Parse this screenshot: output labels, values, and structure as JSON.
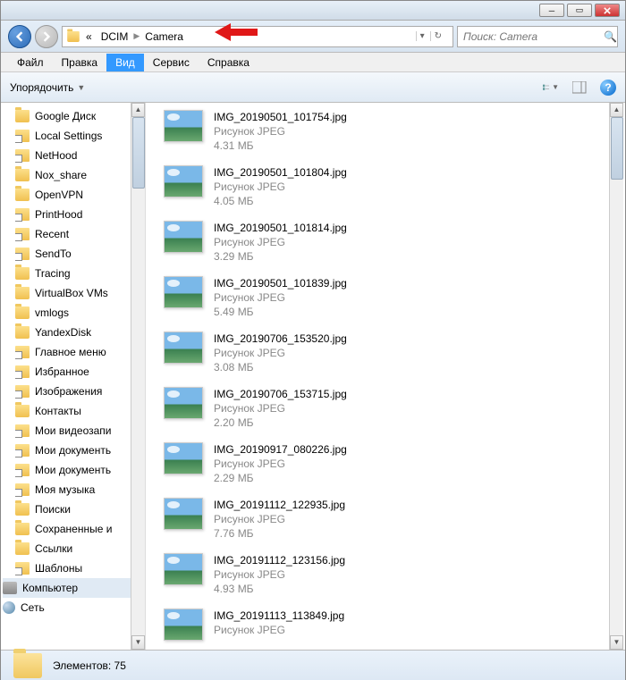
{
  "breadcrumb": {
    "root": "«",
    "p1": "DCIM",
    "p2": "Camera"
  },
  "search": {
    "placeholder": "Поиск: Camera"
  },
  "menu": {
    "file": "Файл",
    "edit": "Правка",
    "view": "Вид",
    "service": "Сервис",
    "help": "Справка"
  },
  "toolbar": {
    "organize": "Упорядочить"
  },
  "sidebar": {
    "items": [
      {
        "label": "Google Диск",
        "icon": "folder"
      },
      {
        "label": "Local Settings",
        "icon": "shortcut"
      },
      {
        "label": "NetHood",
        "icon": "shortcut"
      },
      {
        "label": "Nox_share",
        "icon": "folder"
      },
      {
        "label": "OpenVPN",
        "icon": "folder"
      },
      {
        "label": "PrintHood",
        "icon": "shortcut"
      },
      {
        "label": "Recent",
        "icon": "shortcut"
      },
      {
        "label": "SendTo",
        "icon": "shortcut"
      },
      {
        "label": "Tracing",
        "icon": "folder"
      },
      {
        "label": "VirtualBox VMs",
        "icon": "folder"
      },
      {
        "label": "vmlogs",
        "icon": "folder"
      },
      {
        "label": "YandexDisk",
        "icon": "folder"
      },
      {
        "label": "Главное меню",
        "icon": "shortcut"
      },
      {
        "label": "Избранное",
        "icon": "shortcut"
      },
      {
        "label": "Изображения",
        "icon": "shortcut"
      },
      {
        "label": "Контакты",
        "icon": "folder"
      },
      {
        "label": "Мои видеозапи",
        "icon": "shortcut"
      },
      {
        "label": "Мои документь",
        "icon": "shortcut"
      },
      {
        "label": "Мои документь",
        "icon": "shortcut"
      },
      {
        "label": "Моя музыка",
        "icon": "shortcut"
      },
      {
        "label": "Поиски",
        "icon": "folder"
      },
      {
        "label": "Сохраненные и",
        "icon": "folder"
      },
      {
        "label": "Ссылки",
        "icon": "folder"
      },
      {
        "label": "Шаблоны",
        "icon": "shortcut"
      },
      {
        "label": "Компьютер",
        "icon": "computer",
        "selected": true,
        "outdent": true
      },
      {
        "label": "Сеть",
        "icon": "network",
        "outdent": true
      }
    ]
  },
  "files": [
    {
      "name": "IMG_20190501_101754.jpg",
      "type": "Рисунок JPEG",
      "size": "4.31 МБ"
    },
    {
      "name": "IMG_20190501_101804.jpg",
      "type": "Рисунок JPEG",
      "size": "4.05 МБ"
    },
    {
      "name": "IMG_20190501_101814.jpg",
      "type": "Рисунок JPEG",
      "size": "3.29 МБ"
    },
    {
      "name": "IMG_20190501_101839.jpg",
      "type": "Рисунок JPEG",
      "size": "5.49 МБ"
    },
    {
      "name": "IMG_20190706_153520.jpg",
      "type": "Рисунок JPEG",
      "size": "3.08 МБ"
    },
    {
      "name": "IMG_20190706_153715.jpg",
      "type": "Рисунок JPEG",
      "size": "2.20 МБ"
    },
    {
      "name": "IMG_20190917_080226.jpg",
      "type": "Рисунок JPEG",
      "size": "2.29 МБ"
    },
    {
      "name": "IMG_20191112_122935.jpg",
      "type": "Рисунок JPEG",
      "size": "7.76 МБ"
    },
    {
      "name": "IMG_20191112_123156.jpg",
      "type": "Рисунок JPEG",
      "size": "4.93 МБ"
    },
    {
      "name": "IMG_20191113_113849.jpg",
      "type": "Рисунок JPEG",
      "size": ""
    }
  ],
  "status": {
    "text": "Элементов: 75"
  }
}
